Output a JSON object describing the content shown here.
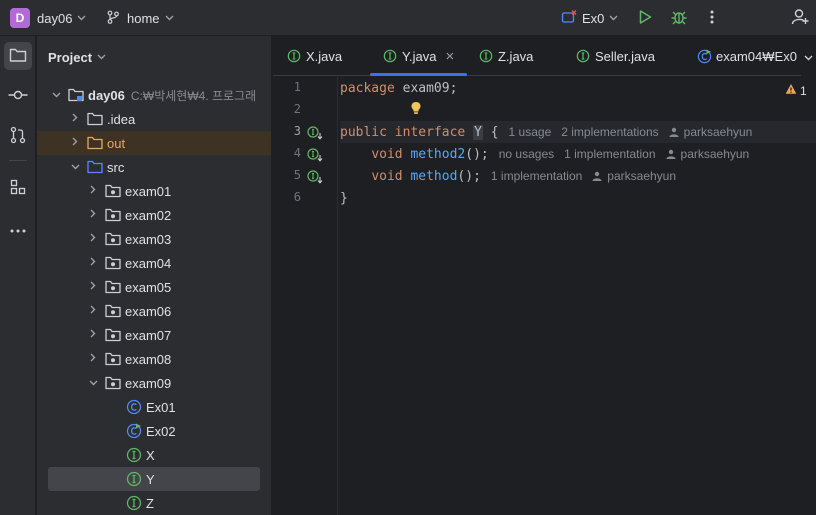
{
  "titlebar": {
    "project_badge": "D",
    "project_name": "day06",
    "branch": "home",
    "run_config": "Ex0",
    "icons": [
      "run-config-icon",
      "run-icon",
      "debug-icon",
      "more-icon",
      "add-user-icon"
    ]
  },
  "toolstrip": {
    "items": [
      "project-folder-icon",
      "commit-icon",
      "pull-requests-icon",
      "structure-icon",
      "more-tools-icon"
    ]
  },
  "project_panel": {
    "title": "Project",
    "root": {
      "name": "day06",
      "path": "C:₩박세현₩4. 프로그래"
    },
    "items": [
      {
        "label": ".idea",
        "type": "folder"
      },
      {
        "label": "out",
        "type": "folder-excluded"
      },
      {
        "label": "src",
        "type": "folder-source"
      },
      {
        "label": "exam01",
        "type": "package"
      },
      {
        "label": "exam02",
        "type": "package"
      },
      {
        "label": "exam03",
        "type": "package"
      },
      {
        "label": "exam04",
        "type": "package"
      },
      {
        "label": "exam05",
        "type": "package"
      },
      {
        "label": "exam06",
        "type": "package"
      },
      {
        "label": "exam07",
        "type": "package"
      },
      {
        "label": "exam08",
        "type": "package"
      },
      {
        "label": "exam09",
        "type": "package"
      },
      {
        "label": "Ex01",
        "type": "class"
      },
      {
        "label": "Ex02",
        "type": "class-run"
      },
      {
        "label": "X",
        "type": "interface"
      },
      {
        "label": "Y",
        "type": "interface"
      },
      {
        "label": "Z",
        "type": "interface"
      }
    ]
  },
  "tabs": [
    {
      "label": "X.java",
      "type": "interface"
    },
    {
      "label": "Y.java",
      "type": "interface",
      "active": true,
      "close": "×"
    },
    {
      "label": "Z.java",
      "type": "interface"
    },
    {
      "label": "Seller.java",
      "type": "interface"
    },
    {
      "label": "exam04₩Ex0",
      "type": "class-run"
    }
  ],
  "editor": {
    "warning_count": "1",
    "line_numbers": [
      "1",
      "2",
      "3",
      "4",
      "5",
      "6"
    ],
    "code": {
      "l1_kw": "package",
      "l1_rest": " exam09;",
      "l3_kw": "public interface",
      "l3_name": "Y",
      "l3_brace": " {",
      "l3_usage": "1 usage",
      "l3_impl": "2 implementations",
      "l3_author": "parksaehyun",
      "l4_kw": "void",
      "l4_fn": "method2",
      "l4_rest": "();",
      "l4_usage": "no usages",
      "l4_impl": "1 implementation",
      "l4_author": "parksaehyun",
      "l5_kw": "void",
      "l5_fn": "method",
      "l5_rest": "();",
      "l5_impl": "1 implementation",
      "l5_author": "parksaehyun",
      "l6": "}"
    }
  },
  "colors": {
    "accent": "#3574f0",
    "keyword": "#cf8e6d",
    "function": "#56a8f5",
    "interface_icon": "#5fb865",
    "class_icon": "#548af7",
    "excluded_folder": "#e8a85c"
  }
}
